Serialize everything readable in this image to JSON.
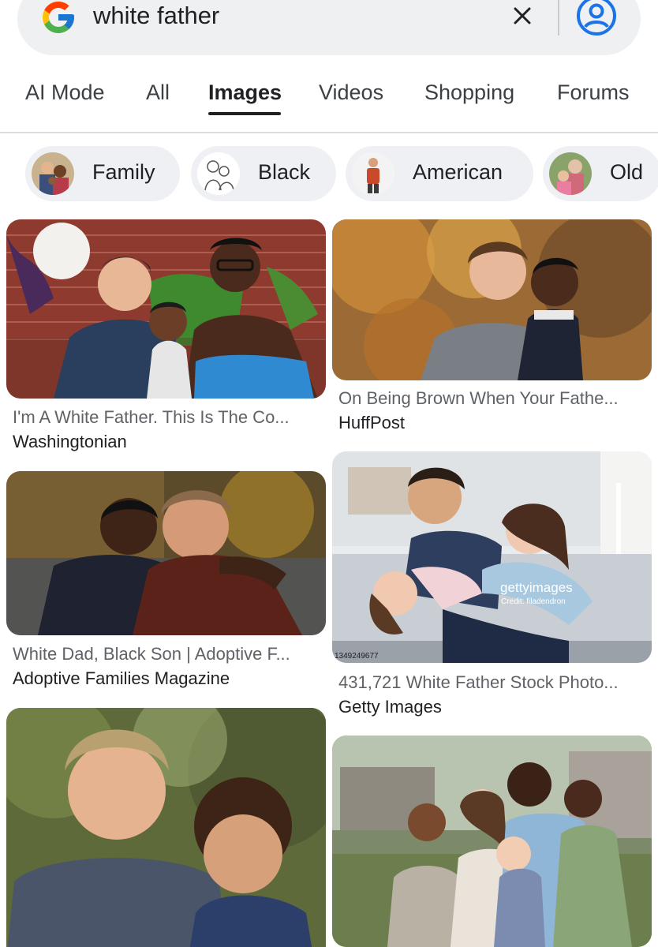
{
  "search": {
    "query": "white father",
    "colors": {
      "bar_bg": "#eef0f2",
      "account": "#1a73e8"
    },
    "icons": {
      "logo": "google-g-logo",
      "clear": "close-icon",
      "account": "account-circle-icon"
    }
  },
  "tabs": [
    {
      "label": "AI Mode",
      "active": false
    },
    {
      "label": "All",
      "active": false
    },
    {
      "label": "Images",
      "active": true
    },
    {
      "label": "Videos",
      "active": false
    },
    {
      "label": "Shopping",
      "active": false
    },
    {
      "label": "Forums",
      "active": false
    }
  ],
  "chips": [
    {
      "label": "Family"
    },
    {
      "label": "Black"
    },
    {
      "label": "American"
    },
    {
      "label": "Old"
    }
  ],
  "results": {
    "left": [
      {
        "title": "I'm A White Father. This Is The Co...",
        "source": "Washingtonian"
      },
      {
        "title": "White Dad, Black Son | Adoptive F...",
        "source": "Adoptive Families Magazine"
      },
      {
        "title": "",
        "source": ""
      }
    ],
    "right": [
      {
        "title": "On Being Brown When Your Fathe...",
        "source": "HuffPost"
      },
      {
        "title": "431,721 White Father Stock Photo...",
        "source": "Getty Images",
        "watermark": "gettyimages",
        "credit": "Credit: filadendron",
        "side_code": "1349249677"
      },
      {
        "title": "",
        "source": ""
      }
    ]
  }
}
